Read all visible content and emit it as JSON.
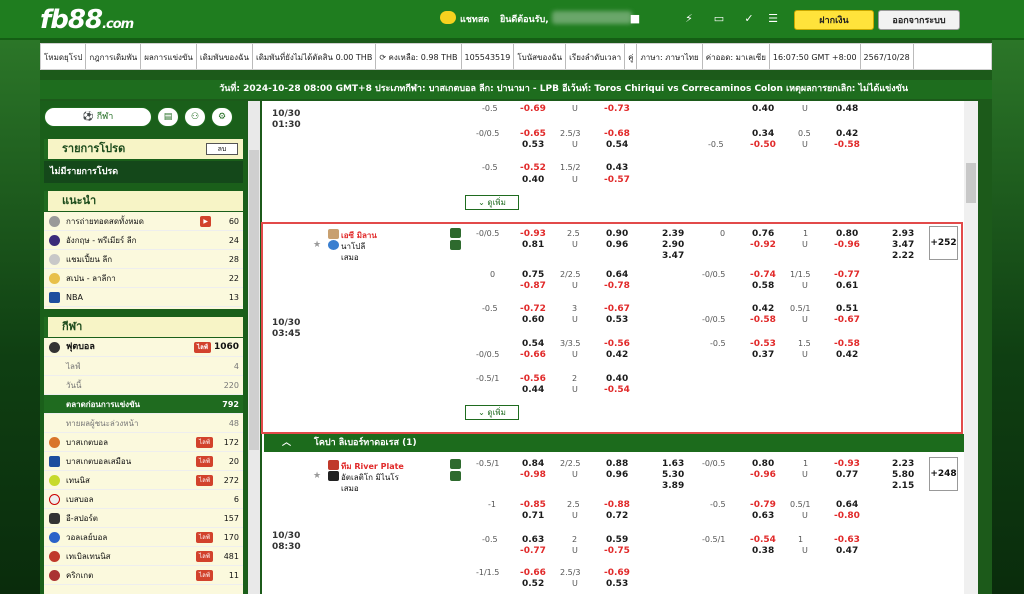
{
  "header": {
    "logo_main": "fb88",
    "logo_suffix": ".com",
    "chat_label": "แชทสด",
    "welcome": "ยินดีต้อนรับ,",
    "deposit_label": "ฝากเงิน",
    "logout_label": "ออกจากระบบ",
    "colors": {
      "brand": "#1f7d1f",
      "deposit": "#ffe33b"
    }
  },
  "menu": {
    "items": [
      "โหมดยุโรป",
      "กฎการเดิมพัน",
      "ผลการแข่งขัน",
      "เดิมพันของฉัน",
      "เดิมพันที่ยังไม่ได้ตัดสิน 0.00 THB",
      "⟳ คงเหลือ: 0.98 THB",
      "105543519",
      "โบนัสของฉัน",
      "เรียงลำดับเวลา",
      "คู่",
      "ภาษา: ภาษาไทย",
      "ค่าออด: มาเลเซีย",
      "16:07:50 GMT +8:00",
      "2567/10/28"
    ]
  },
  "ticker": "วันที่: 2024-10-28 08:00 GMT+8 ประเภทกีฬา: บาสเกตบอล ลีก: ปานามา - LPB อีเว้นท์: Toros Chiriqui vs Correcaminos Colon เหตุผลการยกเลิก: ไม่ได้แข่งขัน",
  "sidebar": {
    "sport_btn": "กีฬา",
    "my_list_title": "รายการโปรด",
    "edit_label": "ลบ",
    "no_fav": "ไม่มีรายการโปรด",
    "featured_title": "แนะนำ",
    "featured": [
      {
        "label": "การถ่ายทอดสดทั้งหมด",
        "count": "60"
      },
      {
        "label": "อังกฤษ - พรีเมียร์ ลีก",
        "count": "24"
      },
      {
        "label": "แชมเปี้ยน ลีก",
        "count": "28"
      },
      {
        "label": "สเปน - ลาลีกา",
        "count": "22"
      },
      {
        "label": "NBA",
        "count": "13"
      }
    ],
    "sports_title": "กีฬา",
    "football": {
      "label": "ฟุตบอล",
      "live": "ไลฟ์",
      "count": "1060"
    },
    "football_sub": [
      {
        "label": "ไลฟ์",
        "count": "4"
      },
      {
        "label": "วันนี้",
        "count": "220"
      },
      {
        "label": "ตลาดก่อนการแข่งขัน",
        "count": "792"
      },
      {
        "label": "ทายผลผู้ชนะล่วงหน้า",
        "count": "48"
      }
    ],
    "sports": [
      {
        "label": "บาสเกตบอล",
        "live": "ไลฟ์",
        "count": "172"
      },
      {
        "label": "บาสเกตบอลเสมือน",
        "live": "ไลฟ์",
        "count": "20"
      },
      {
        "label": "เทนนิส",
        "live": "ไลฟ์",
        "count": "272"
      },
      {
        "label": "เบสบอล",
        "live": "",
        "count": "6"
      },
      {
        "label": "อี-สปอร์ต",
        "live": "",
        "count": "157"
      },
      {
        "label": "วอลเลย์บอล",
        "live": "ไลฟ์",
        "count": "170"
      },
      {
        "label": "เทเบิลเทนนิส",
        "live": "ไลฟ์",
        "count": "481"
      },
      {
        "label": "คริกเกต",
        "live": "ไลฟ์",
        "count": "11"
      }
    ]
  },
  "main": {
    "more_label": "ดูเพิ่ม",
    "league2": "โคปา ลิเบอร์ทาดอเรส (1)",
    "match0": {
      "date": "10/30",
      "time": "01:30"
    },
    "match1": {
      "date": "10/30",
      "time": "03:45",
      "home": "เอซี มิลาน",
      "away": "นาโปลี",
      "draw": "เสมอ",
      "plus": "+252"
    },
    "match2": {
      "date": "10/30",
      "time": "08:30",
      "home": "ทีม River Plate",
      "away": "อัตเลติโก มิไนโร",
      "draw": "เสมอ",
      "plus": "+248"
    }
  }
}
